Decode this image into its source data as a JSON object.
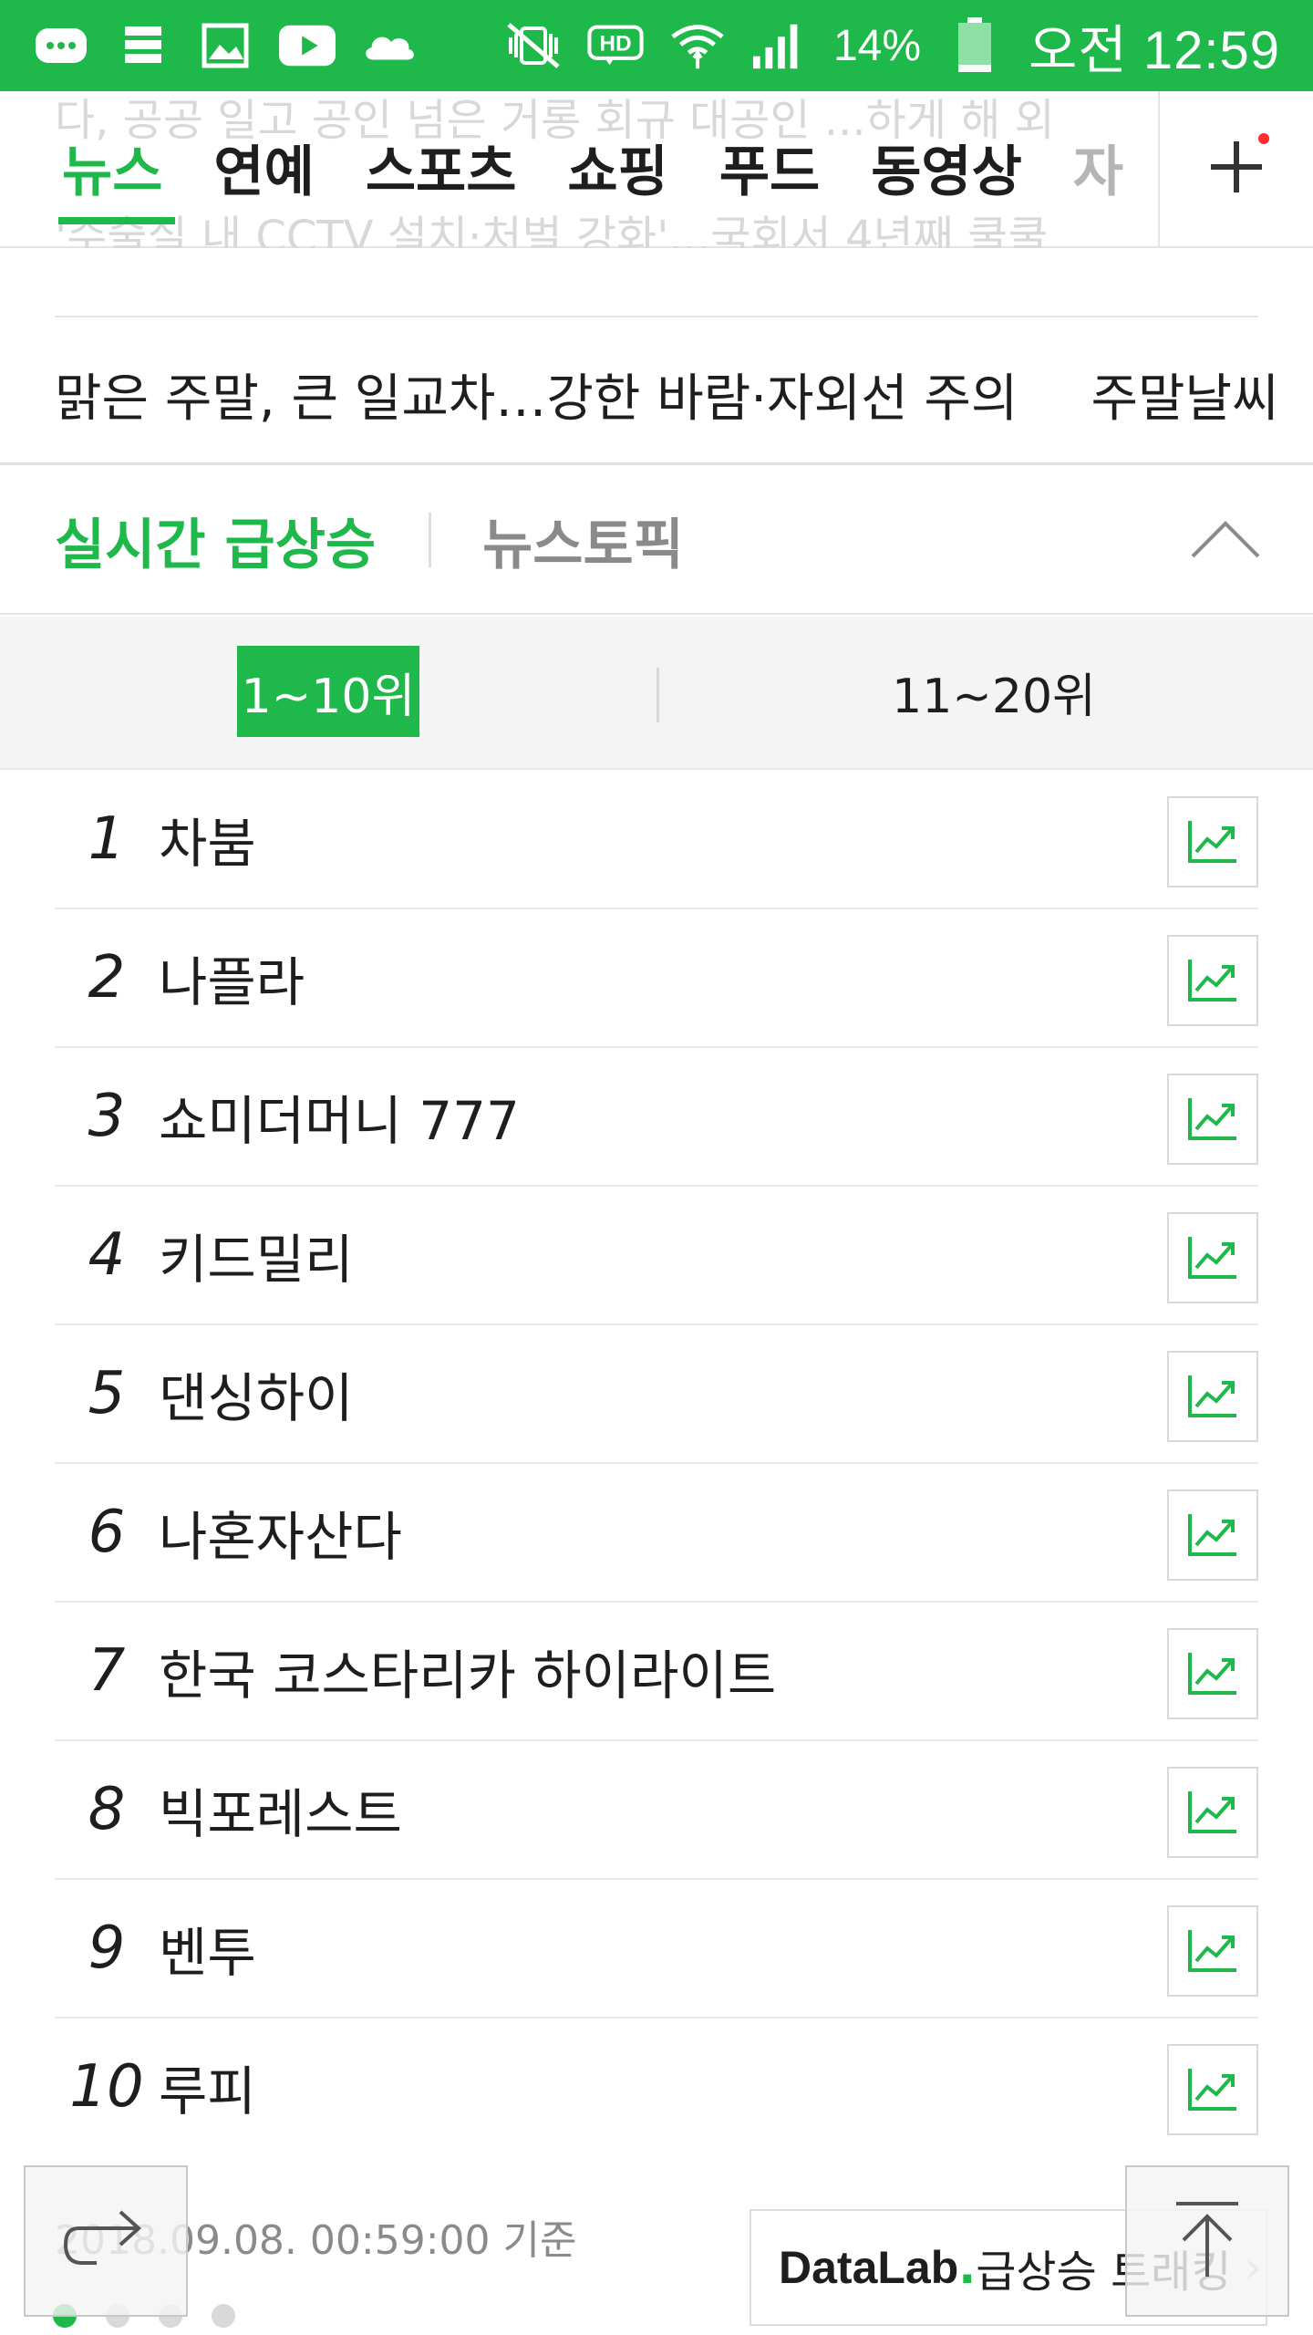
{
  "status_bar": {
    "battery_percent": "14%",
    "time": "오전 12:59",
    "icons": [
      "chat-icon",
      "stack-icon",
      "image-icon",
      "youtube-icon",
      "cloud-icon",
      "mute-vibrate-icon",
      "hd-icon",
      "wifi-icon",
      "signal-icon",
      "battery-icon"
    ]
  },
  "nav": {
    "tabs": [
      "뉴스",
      "연예",
      "스포츠",
      "쇼핑",
      "푸드",
      "동영상",
      "자"
    ],
    "ghost_top": "다, 공공 일고 공인 넘은 거롱 회규 대공인 ...하게 해 외",
    "ghost_bottom": "'수술실 내 CCTV 설치·처벌 강화'...국회서 4년째 쿨쿨",
    "plus_label": "+"
  },
  "headline": {
    "text": "맑은 주말, 큰 일교차…강한 바람·자외선 주의",
    "tag": "주말날씨"
  },
  "realtime": {
    "title": "실시간 급상승",
    "topic": "뉴스토픽",
    "ranges": [
      "1~10위",
      "11~20위"
    ],
    "items": [
      {
        "rank": "1",
        "keyword": "차붐"
      },
      {
        "rank": "2",
        "keyword": "나플라"
      },
      {
        "rank": "3",
        "keyword": "쇼미더머니 777"
      },
      {
        "rank": "4",
        "keyword": "키드밀리"
      },
      {
        "rank": "5",
        "keyword": "댄싱하이"
      },
      {
        "rank": "6",
        "keyword": "나혼자산다"
      },
      {
        "rank": "7",
        "keyword": "한국 코스타리카 하이라이트"
      },
      {
        "rank": "8",
        "keyword": "빅포레스트"
      },
      {
        "rank": "9",
        "keyword": "벤투"
      },
      {
        "rank": "10",
        "keyword": "루피"
      }
    ]
  },
  "footer": {
    "timestamp": "2018.09.08. 00:59:00 기준",
    "datalab_brand": "DataLab",
    "datalab_dot": ".",
    "datalab_label": "급상승 트래킹",
    "datalab_chevron": "›"
  },
  "colors": {
    "accent": "#1fb84a",
    "text": "#1e1e1e",
    "muted": "#8a8a8a"
  }
}
